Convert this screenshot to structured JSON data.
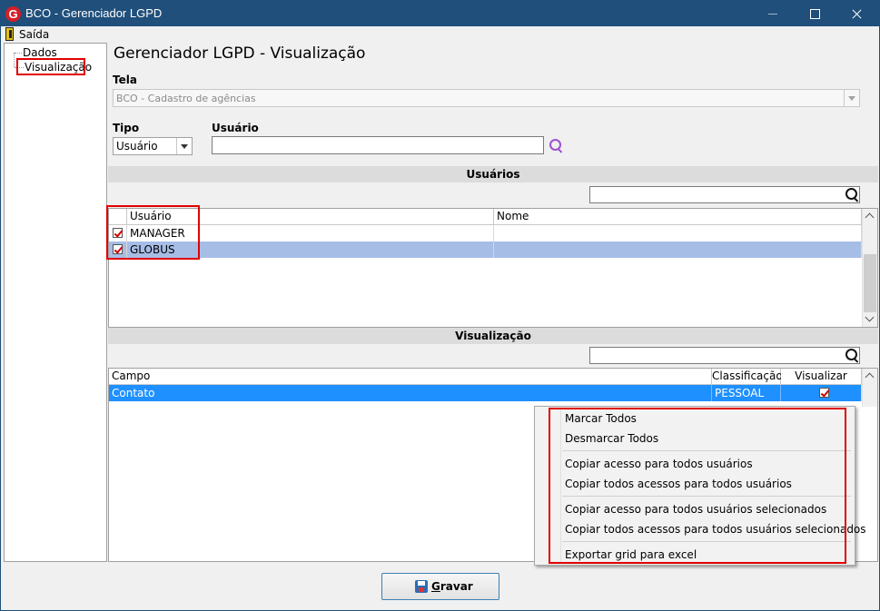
{
  "window": {
    "title": "BCO - Gerenciador LGPD",
    "icon": "app-logo-icon",
    "icon_letter": "G"
  },
  "menu": {
    "exit_label": "Saída"
  },
  "tree": {
    "items": [
      {
        "label": "Dados"
      },
      {
        "label": "Visualização",
        "selected": true
      }
    ]
  },
  "page": {
    "title": "Gerenciador LGPD - Visualização",
    "tela_label": "Tela",
    "tela_value": "BCO - Cadastro de agências",
    "tipo_label": "Tipo",
    "tipo_value": "Usuário",
    "usuario_label": "Usuário",
    "usuario_value": ""
  },
  "users_section": {
    "title": "Usuários",
    "filter_value": "",
    "columns": [
      "Usuário",
      "Nome"
    ],
    "rows": [
      {
        "checked": true,
        "usuario": "MANAGER",
        "nome": ""
      },
      {
        "checked": true,
        "usuario": "GLOBUS",
        "nome": "",
        "selected": true
      }
    ]
  },
  "view_section": {
    "title": "Visualização",
    "filter_value": "",
    "columns": [
      "Campo",
      "Classificação",
      "Visualizar"
    ],
    "rows": [
      {
        "campo": "Contato",
        "classificacao": "PESSOAL",
        "visualizar": true,
        "selected": true
      }
    ]
  },
  "context_menu": {
    "items": [
      "Marcar Todos",
      "Desmarcar Todos",
      "Copiar acesso para todos usuários",
      "Copiar todos acessos para todos usuários",
      "Copiar acesso para todos usuários selecionados",
      "Copiar todos acessos para todos usuários selecionados",
      "Exportar grid para excel"
    ]
  },
  "footer": {
    "save_label_first": "G",
    "save_label_rest": "ravar"
  },
  "colors": {
    "titlebar": "#1f4f7a",
    "selected_row_light": "#a6bde6",
    "selected_row_blue": "#1e90ff",
    "highlight_red": "#e00000"
  }
}
